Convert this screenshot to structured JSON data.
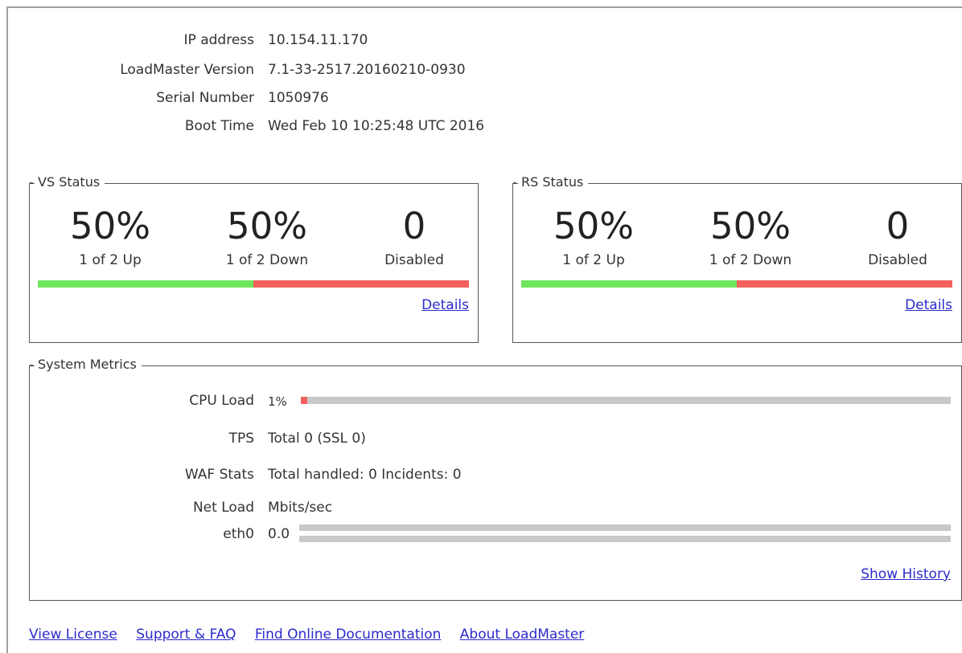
{
  "info": [
    {
      "label": "IP address",
      "value": "10.154.11.170"
    },
    {
      "label": "LoadMaster Version",
      "value": "7.1-33-2517.20160210-0930"
    },
    {
      "label": "Serial Number",
      "value": "1050976"
    },
    {
      "label": "Boot Time",
      "value": "Wed Feb 10 10:25:48 UTC 2016"
    }
  ],
  "vs_status": {
    "title": "VS Status",
    "up_pct": "50%",
    "up_label": "1 of 2 Up",
    "down_pct": "50%",
    "down_label": "1 of 2 Down",
    "disabled_count": "0",
    "disabled_label": "Disabled",
    "up_fraction": 0.5,
    "details": "Details"
  },
  "rs_status": {
    "title": "RS Status",
    "up_pct": "50%",
    "up_label": "1 of 2 Up",
    "down_pct": "50%",
    "down_label": "1 of 2 Down",
    "disabled_count": "0",
    "disabled_label": "Disabled",
    "up_fraction": 0.5,
    "details": "Details"
  },
  "metrics": {
    "title": "System Metrics",
    "cpu_label": "CPU Load",
    "cpu_value": "1%",
    "cpu_fraction": 0.01,
    "tps_label": "TPS",
    "tps_value": "Total 0 (SSL 0)",
    "waf_label": "WAF Stats",
    "waf_value": "Total handled: 0 Incidents: 0",
    "net_label": "Net Load",
    "net_value": "Mbits/sec",
    "eth_label": "eth0",
    "eth_value": "0.0",
    "show_history": "Show History"
  },
  "footer": {
    "view_license": "View License",
    "support": "Support & FAQ",
    "docs": "Find Online Documentation",
    "about": "About LoadMaster"
  },
  "colors": {
    "up": "#6fe55e",
    "down": "#f4605c",
    "link": "#2b2bcc",
    "track": "#c8c8c8"
  }
}
